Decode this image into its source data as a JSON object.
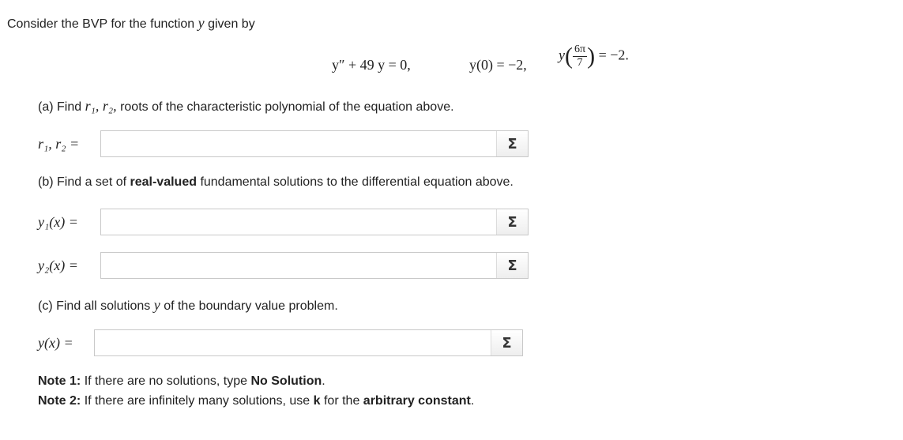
{
  "intro": {
    "text": "Consider the BVP for the function",
    "var": "y",
    "tail": "given by"
  },
  "equation": {
    "ode_lhs": "y″ + 49 y = 0,",
    "bc1": "y(0) = −2,",
    "bc2_y": "y",
    "bc2_num": "6π",
    "bc2_den": "7",
    "bc2_rhs": "= −2."
  },
  "part_a": {
    "prefix": "(a) Find",
    "vars": "r₁, r₂,",
    "rest": "roots of the characteristic polynomial of the equation above.",
    "label": "r₁, r₂ =",
    "input_value": "",
    "sigma": "Σ"
  },
  "part_b": {
    "prefix": "(b) Find a set of",
    "bold": "real-valued",
    "rest": "fundamental solutions to the differential equation above.",
    "y1_label": "y₁(x) =",
    "y1_value": "",
    "y2_label": "y₂(x) =",
    "y2_value": "",
    "sigma": "Σ"
  },
  "part_c": {
    "prefix": "(c) Find all solutions",
    "var": "y",
    "rest": "of the boundary value problem.",
    "label": "y(x) =",
    "input_value": "",
    "sigma": "Σ"
  },
  "notes": {
    "note1_label": "Note 1:",
    "note1_text": "If there are no solutions, type",
    "note1_bold": "No Solution",
    "note1_end": ".",
    "note2_label": "Note 2:",
    "note2_text": "If there are infinitely many solutions, use",
    "note2_k": "k",
    "note2_mid": "for the",
    "note2_bold": "arbitrary constant",
    "note2_end": "."
  }
}
